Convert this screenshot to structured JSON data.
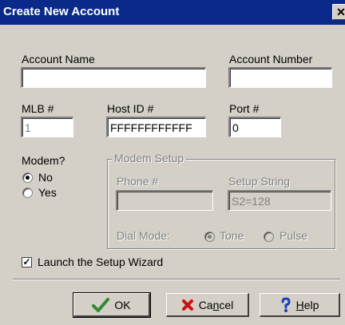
{
  "window": {
    "title": "Create New Account",
    "close_label": "✕"
  },
  "labels": {
    "account_name": "Account Name",
    "account_number": "Account Number",
    "mlb": "MLB #",
    "host_id": "Host ID #",
    "port": "Port #",
    "modem": "Modem?",
    "modem_no": "No",
    "modem_yes": "Yes",
    "modem_setup": "Modem Setup",
    "phone": "Phone #",
    "setup_string": "Setup String",
    "dial_mode": "Dial Mode:",
    "tone": "Tone",
    "pulse": "Pulse",
    "launch_wizard": "Launch the Setup Wizard"
  },
  "fields": {
    "account_name": "",
    "account_number": "",
    "mlb": "1",
    "host_id": "FFFFFFFFFFFF",
    "port": "0",
    "phone": "",
    "setup_string": "S2=128"
  },
  "state": {
    "modem": "No",
    "dial_mode": "Tone",
    "launch_wizard": true
  },
  "buttons": {
    "ok": "OK",
    "cancel_prefix": "Ca",
    "cancel_ul": "n",
    "cancel_suffix": "cel",
    "help_prefix": "",
    "help_ul": "H",
    "help_suffix": "elp"
  },
  "colors": {
    "titlebar": "#0a2a8a",
    "face": "#d4d0c8",
    "ok_check": "#2e8b2e",
    "cancel_x": "#cc1111",
    "help_q": "#1a3fbf"
  },
  "icons": [
    "close-icon",
    "check-icon",
    "x-icon",
    "question-icon"
  ]
}
